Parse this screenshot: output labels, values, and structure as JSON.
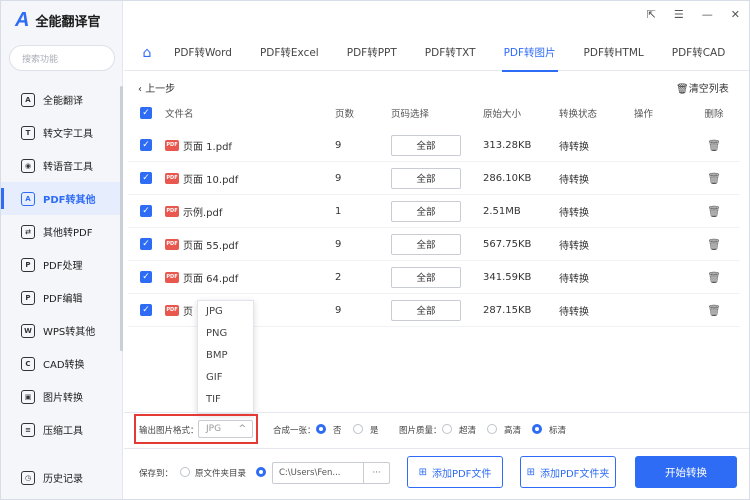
{
  "app": {
    "logo_mark": "A",
    "title": "全能翻译官"
  },
  "window_controls": [
    "⇱",
    "☰",
    "—",
    "✕"
  ],
  "sidebar": {
    "search_placeholder": "搜索功能",
    "items": [
      {
        "label": "全能翻译",
        "icon": "A"
      },
      {
        "label": "转文字工具",
        "icon": "T"
      },
      {
        "label": "转语音工具",
        "icon": "◉"
      },
      {
        "label": "PDF转其他",
        "icon": "A",
        "active": true
      },
      {
        "label": "其他转PDF",
        "icon": "⇄"
      },
      {
        "label": "PDF处理",
        "icon": "P"
      },
      {
        "label": "PDF编辑",
        "icon": "P"
      },
      {
        "label": "WPS转其他",
        "icon": "W"
      },
      {
        "label": "CAD转换",
        "icon": "C"
      },
      {
        "label": "图片转换",
        "icon": "▣"
      },
      {
        "label": "压缩工具",
        "icon": "≡"
      }
    ],
    "history": "历史记录"
  },
  "tabs": [
    "PDF转Word",
    "PDF转Excel",
    "PDF转PPT",
    "PDF转TXT",
    "PDF转图片",
    "PDF转HTML",
    "PDF转CAD"
  ],
  "active_tab": 4,
  "toolbar": {
    "back": "上一步",
    "clear": "清空列表"
  },
  "table": {
    "headers": [
      "文件名",
      "页数",
      "页码选择",
      "原始大小",
      "转换状态",
      "操作",
      "删除"
    ],
    "rows": [
      {
        "name": "页面 1.pdf",
        "pages": "9",
        "select": "全部",
        "size": "313.28KB",
        "status": "待转换"
      },
      {
        "name": "页面 10.pdf",
        "pages": "9",
        "select": "全部",
        "size": "286.10KB",
        "status": "待转换"
      },
      {
        "name": "示例.pdf",
        "pages": "1",
        "select": "全部",
        "size": "2.51MB",
        "status": "待转换"
      },
      {
        "name": "页面 55.pdf",
        "pages": "9",
        "select": "全部",
        "size": "567.75KB",
        "status": "待转换"
      },
      {
        "name": "页面 64.pdf",
        "pages": "2",
        "select": "全部",
        "size": "341.59KB",
        "status": "待转换"
      },
      {
        "name": "页",
        "pages": "9",
        "select": "全部",
        "size": "287.15KB",
        "status": "待转换"
      }
    ]
  },
  "dropdown_options": [
    "JPG",
    "PNG",
    "BMP",
    "GIF",
    "TIF"
  ],
  "settings": {
    "format_label": "输出图片格式：",
    "format_value": "JPG",
    "merge_label": "合成一张：",
    "merge_no": "否",
    "merge_yes": "是",
    "quality_label": "图片质量：",
    "quality_options": [
      "超清",
      "高清",
      "标清"
    ]
  },
  "save": {
    "label": "保存到：",
    "source_option": "原文件夹目录",
    "path": "C:\\Users\\Fen...",
    "dots": "···",
    "add_file": "添加PDF文件",
    "add_folder": "添加PDF文件夹",
    "start": "开始转换"
  },
  "colors": {
    "accent": "#2f6cf6",
    "highlight_border": "#e53935",
    "pdf_icon": "#e8584f"
  }
}
